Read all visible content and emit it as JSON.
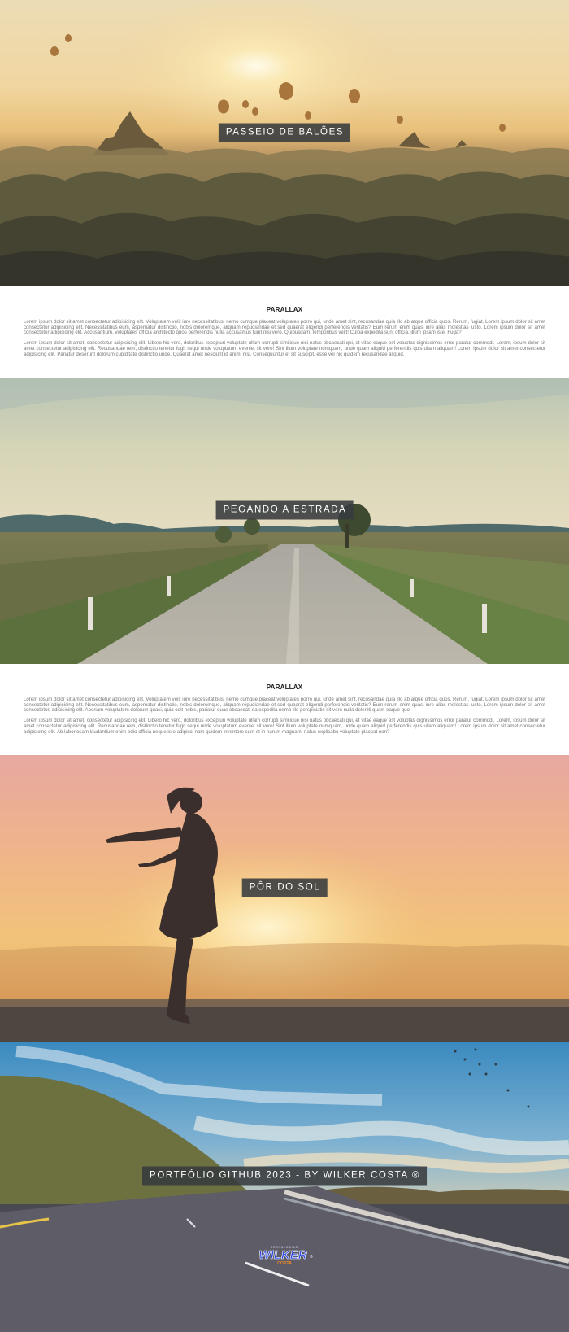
{
  "sections": [
    {
      "id": "balloons",
      "caption": "PASSEIO DE BALÕES"
    },
    {
      "id": "road",
      "caption": "PEGANDO A ESTRADA"
    },
    {
      "id": "sunset",
      "caption": "PÔR DO SOL"
    },
    {
      "id": "footer",
      "caption": "PORTFÓLIO GITHUB 2023 - BY WILKER COSTA ®"
    }
  ],
  "text_blocks": [
    {
      "title": "PARALLAX",
      "paragraphs": [
        "Lorem ipsum dolor sit amet consectetur adipisicing elit. Voluptatem velit iure necessitatibus, nemo cumque placeat voluptates porro qui, unde amet sint, recusandae quia illo ab atque officia quos. Rerum, fugiat. Lorem ipsum dolor sit amet consectetur adipisicing elit. Necessitatibus eum, aspernatur distinctio, nobis doloremque, aliquam repudiandae et sed quaerat eligendi perferendis veritatis? Eum rerum enim quasi iure alias molestias iusto. Lorem ipsum dolor sit amet consectetur adipisicing elit. Accusantium, voluptates officia architecto quos perferendis nulla accusamus fugit nisi vero. Quibusdam, temporibus velit! Culpa expedita sunt officia, illum ipsam iste. Fuga?",
        "Lorem ipsum dolor sit amet, consectetur adipisicing elit. Libero hic vero, doloribus excepturi voluptate ullam corrupti similique nisi natus obcaecati qui, et vitae eaque est voluptas dignissimos error paratur commodi. Lorem, ipsum dolor sit amet consectetur adipisicing elit. Recusandae rem, distinctio tenetur fugit sequi unde voluptatum eveniet sit vero! Sint illum voluptate numquam, unde quam aliquid perferendis quis ullam aliquam! Lorem ipsum dolor sit amet consectetur adipisicing elit. Pariatur deserunt dolorum cupiditate distinctio unde. Quaerat amet nesciunt id animi nisi. Consequuntur et sit suscipit, esse vel hic quidem recusandae aliquid."
      ]
    },
    {
      "title": "PARALLAX",
      "paragraphs": [
        "Lorem ipsum dolor sit amet consectetur adipisicing elit. Voluptatem velit iure necessitatibus, nemo cumque placeat voluptates porro qui, unde amet sint, recusandae quia illo ab atque officia quos. Rerum, fugiat. Lorem ipsum dolor sit amet consectetur adipisicing elit. Necessitatibus eum, aspernatur distinctio, nobis doloremque, aliquam repudiandae et sed quaerat eligendi perferendis veritatis? Eum rerum enim quasi iure alias molestias iusto. Lorem ipsum dolor sit amet consectetur, adipisicing elit. Aperiam voluptatem dolorum quasi, quia odit nobis, pariatur quas obcaecati ea expedita nemo illo perspiciatis sit vero nulla deleniti quam eaque quo!",
        "Lorem ipsum dolor sit amet, consectetur adipisicing elit. Libero hic vero, doloribus excepturi voluptate ullam corrupti similique nisi natus obcaecati qui, et vitae eaque est voluptas dignissimos error paratur commodi. Lorem, ipsum dolor sit amet consectetur adipisicing elit. Recusandae rem, distinctio tenetur fugit sequi unde voluptatum eveniet sit vero! Sint illum voluptate numquam, unde quam aliquid perferendis quis ullam aliquam! Lorem ipsum dolor sit amet consectetur adipisicing elit. Ab laboriosam laudantium enim odio officia neque iste adipisci nam quidem inventore sunt et in harum magnam, natus explicabo voluptate placeat non?"
      ]
    }
  ],
  "logo": {
    "top_text": "TECNOLOGIAS",
    "name": "WILKER",
    "sub": "COSTA",
    "mark": "®"
  }
}
